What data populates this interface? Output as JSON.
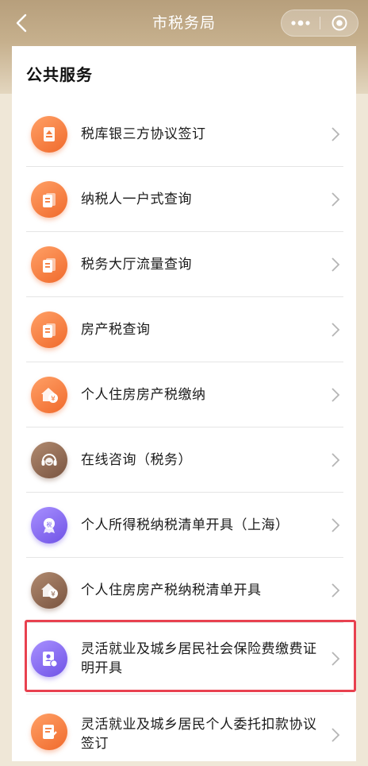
{
  "nav": {
    "title": "市税务局",
    "back_icon": "chevron-left-icon",
    "more_icon": "more-dots-icon",
    "close_icon": "target-circle-icon"
  },
  "section": {
    "title": "公共服务"
  },
  "items": [
    {
      "label": "税库银三方协议签订",
      "icon": "document-upload-icon",
      "color": "#f47b3c"
    },
    {
      "label": "纳税人一户式查询",
      "icon": "document-stack-icon",
      "color": "#f47b3c"
    },
    {
      "label": "税务大厅流量查询",
      "icon": "document-stack-icon",
      "color": "#f47b3c"
    },
    {
      "label": "房产税查询",
      "icon": "document-icon",
      "color": "#f47b3c"
    },
    {
      "label": "个人住房房产税缴纳",
      "icon": "house-yen-icon",
      "color": "#f47b3c"
    },
    {
      "label": "在线咨询（税务）",
      "icon": "headset-icon",
      "color": "#8f6a55"
    },
    {
      "label": "个人所得税纳税清单开具（上海）",
      "icon": "tax-badge-icon",
      "color": "#7c61f0"
    },
    {
      "label": "个人住房房产税纳税清单开具",
      "icon": "house-yen-icon",
      "color": "#8f6a55"
    },
    {
      "label": "灵活就业及城乡居民社会保险费缴费证明开具",
      "icon": "certificate-icon",
      "color": "#7c61f0"
    },
    {
      "label": "灵活就业及城乡居民个人委托扣款协议签订",
      "icon": "signature-document-icon",
      "color": "#f47b3c"
    }
  ],
  "highlight_color": "#e8414f"
}
